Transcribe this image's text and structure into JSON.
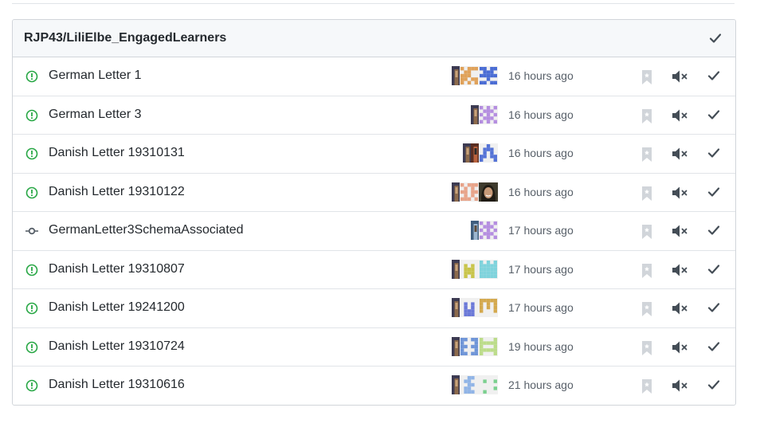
{
  "repo": {
    "name": "RJP43/LiliElbe_EngagedLearners"
  },
  "colors": {
    "issue_open": "#28a745",
    "commit": "#586069",
    "muted_icon": "#d1d5da",
    "action_icon": "#444d56"
  },
  "icons": {
    "issue": "issue-opened-icon",
    "commit": "git-commit-icon",
    "bookmark": "bookmark-icon",
    "mute": "mute-icon",
    "done": "check-icon"
  },
  "notifications": [
    {
      "type": "issue",
      "title": "German Letter 1",
      "time": "16 hours ago",
      "avatars": [
        {
          "kind": "photo",
          "narrow": true
        },
        {
          "kind": "ident",
          "color": "#e0a25a",
          "pattern": [
            1,
            0,
            1,
            1,
            1,
            0,
            1,
            1,
            0,
            0,
            1,
            1,
            1,
            0,
            0,
            1,
            1,
            0,
            1,
            1,
            1,
            0,
            1,
            0,
            1
          ]
        },
        {
          "kind": "ident",
          "color": "#4a6cd4",
          "pattern": [
            1,
            1,
            0,
            1,
            1,
            0,
            1,
            1,
            1,
            0,
            1,
            1,
            1,
            1,
            1,
            0,
            0,
            1,
            0,
            0,
            1,
            1,
            0,
            1,
            1
          ]
        }
      ]
    },
    {
      "type": "issue",
      "title": "German Letter 3",
      "time": "16 hours ago",
      "avatars": [
        {
          "kind": "photo",
          "narrow": true
        },
        {
          "kind": "ident",
          "color": "#b58ee0",
          "pattern": [
            1,
            0,
            1,
            0,
            1,
            0,
            1,
            1,
            1,
            0,
            1,
            0,
            1,
            0,
            1,
            0,
            1,
            1,
            1,
            0,
            1,
            0,
            1,
            0,
            1
          ]
        }
      ]
    },
    {
      "type": "issue",
      "title": "Danish Letter 19310131",
      "time": "16 hours ago",
      "avatars": [
        {
          "kind": "photo",
          "narrow": true
        },
        {
          "kind": "photo2",
          "narrow": true
        },
        {
          "kind": "ident",
          "color": "#5573d6",
          "pattern": [
            0,
            0,
            1,
            0,
            0,
            0,
            1,
            1,
            1,
            0,
            0,
            1,
            0,
            1,
            0,
            1,
            1,
            0,
            1,
            1,
            1,
            0,
            0,
            0,
            1
          ]
        }
      ]
    },
    {
      "type": "issue",
      "title": "Danish Letter 19310122",
      "time": "16 hours ago",
      "avatars": [
        {
          "kind": "photo",
          "narrow": true
        },
        {
          "kind": "ident",
          "color": "#e8a48a",
          "pattern": [
            1,
            0,
            1,
            1,
            1,
            0,
            1,
            0,
            1,
            0,
            1,
            1,
            0,
            1,
            1,
            0,
            1,
            0,
            1,
            0,
            1,
            1,
            1,
            0,
            1
          ]
        },
        {
          "kind": "face"
        }
      ]
    },
    {
      "type": "commit",
      "title": "GermanLetter3SchemaAssociated",
      "time": "17 hours ago",
      "avatars": [
        {
          "kind": "photo3",
          "narrow": true
        },
        {
          "kind": "ident",
          "color": "#b58ee0",
          "pattern": [
            1,
            0,
            1,
            0,
            1,
            0,
            1,
            1,
            1,
            0,
            1,
            0,
            1,
            0,
            1,
            0,
            1,
            1,
            1,
            0,
            1,
            0,
            1,
            0,
            1
          ]
        }
      ]
    },
    {
      "type": "issue",
      "title": "Danish Letter 19310807",
      "time": "17 hours ago",
      "avatars": [
        {
          "kind": "photo",
          "narrow": true
        },
        {
          "kind": "ident",
          "color": "#c8c44a",
          "pattern": [
            0,
            0,
            0,
            0,
            0,
            0,
            1,
            0,
            1,
            0,
            0,
            1,
            1,
            1,
            0,
            0,
            1,
            1,
            1,
            0,
            0,
            1,
            0,
            1,
            0
          ]
        },
        {
          "kind": "ident",
          "color": "#7fd3dc",
          "pattern": [
            1,
            0,
            1,
            0,
            1,
            1,
            1,
            1,
            1,
            1,
            1,
            1,
            1,
            1,
            1,
            1,
            1,
            1,
            1,
            1,
            1,
            1,
            1,
            1,
            1
          ]
        }
      ]
    },
    {
      "type": "issue",
      "title": "Danish Letter 19241200",
      "time": "17 hours ago",
      "avatars": [
        {
          "kind": "photo",
          "narrow": true
        },
        {
          "kind": "ident",
          "color": "#6a78d8",
          "pattern": [
            0,
            0,
            0,
            0,
            0,
            0,
            1,
            0,
            1,
            0,
            0,
            1,
            0,
            1,
            0,
            0,
            1,
            1,
            1,
            0,
            0,
            1,
            1,
            1,
            0
          ]
        },
        {
          "kind": "ident",
          "color": "#d4a94e",
          "pattern": [
            1,
            1,
            1,
            1,
            1,
            1,
            0,
            1,
            0,
            1,
            1,
            0,
            1,
            0,
            1,
            1,
            0,
            0,
            0,
            1,
            0,
            0,
            0,
            0,
            0
          ]
        }
      ]
    },
    {
      "type": "issue",
      "title": "Danish Letter 19310724",
      "time": "19 hours ago",
      "avatars": [
        {
          "kind": "photo",
          "narrow": true
        },
        {
          "kind": "ident",
          "color": "#6f95d8",
          "pattern": [
            1,
            1,
            0,
            1,
            1,
            1,
            0,
            0,
            0,
            1,
            1,
            1,
            0,
            1,
            1,
            1,
            0,
            0,
            0,
            1,
            1,
            1,
            0,
            1,
            1
          ]
        },
        {
          "kind": "ident",
          "color": "#bcdc8a",
          "pattern": [
            1,
            0,
            0,
            0,
            1,
            1,
            1,
            1,
            1,
            1,
            1,
            0,
            0,
            0,
            1,
            1,
            1,
            1,
            1,
            1,
            1,
            0,
            0,
            0,
            1
          ]
        }
      ]
    },
    {
      "type": "issue",
      "title": "Danish Letter 19310616",
      "time": "21 hours ago",
      "avatars": [
        {
          "kind": "photo",
          "narrow": true
        },
        {
          "kind": "ident",
          "color": "#90b4e6",
          "pattern": [
            0,
            0,
            1,
            1,
            0,
            0,
            1,
            1,
            0,
            0,
            0,
            0,
            1,
            1,
            0,
            0,
            1,
            1,
            0,
            0,
            0,
            1,
            1,
            1,
            0
          ]
        },
        {
          "kind": "ident",
          "color": "#7bd08f",
          "pattern": [
            0,
            0,
            0,
            0,
            0,
            0,
            1,
            0,
            0,
            1,
            0,
            0,
            0,
            0,
            0,
            0,
            0,
            0,
            0,
            1,
            0,
            1,
            0,
            0,
            0
          ]
        }
      ]
    }
  ]
}
